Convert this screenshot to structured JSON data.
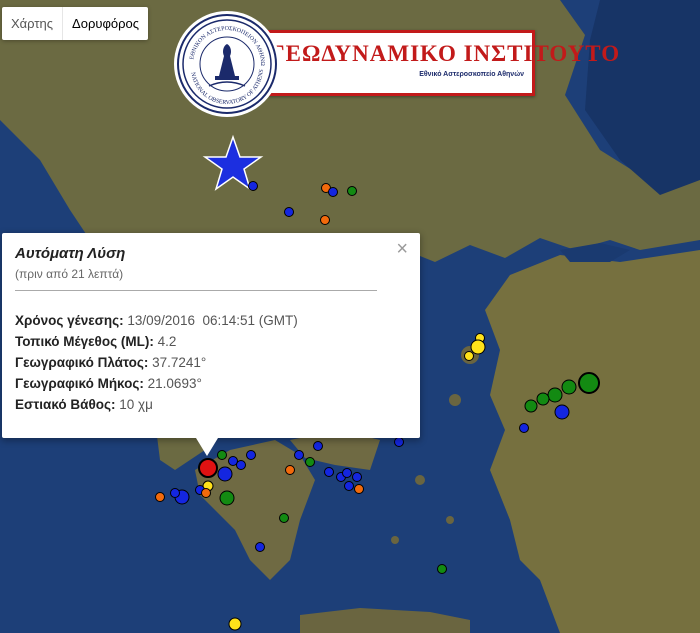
{
  "map_type_control": {
    "map_label": "Χάρτης",
    "satellite_label": "Δορυφόρος",
    "selected": "satellite"
  },
  "logo": {
    "title": "ΓΕΩΔΥΝΑΜΙΚΟ ΙΝΣΤΙΤΟΥΤΟ",
    "subtitle": "Εθνικό Αστεροσκοπείο Αθηνών",
    "seal_top": "ΕΘΝΙΚΟΝ ΑΣΤΕΡΟΣΚΟΠΕΙΟΝ ΑΘΗΝΩΝ",
    "seal_bottom": "NATIONAL OBSERVATORY OF ATHENS"
  },
  "infowindow": {
    "title": "Αυτόματη Λύση",
    "ago": "(πριν από 21 λεπτά)",
    "close_symbol": "×",
    "origin_time_label": "Χρόνος γένεσης:",
    "origin_time_value": "13/09/2016  06:14:51 (GMT)",
    "magnitude_label": "Τοπικό Μέγεθος (ML):",
    "magnitude_value": "4.2",
    "latitude_label": "Γεωγραφικό Πλάτος:",
    "latitude_value": "37.7241°",
    "longitude_label": "Γεωγραφικό Μήκος:",
    "longitude_value": "21.0693°",
    "depth_label": "Εστιακό Βάθος:",
    "depth_value": "10 χμ"
  },
  "colors": {
    "sea": "#1d3f78",
    "land": "#6f6a43",
    "marker_blue": "#1426e0",
    "marker_green": "#138a12",
    "marker_orange": "#f26a0c",
    "marker_yellow": "#ffe21a",
    "marker_red": "#e01212",
    "star": "#1c2fe0",
    "logo_red": "#c21a1a"
  },
  "icons": {
    "close": "close-icon",
    "star": "star-icon"
  }
}
